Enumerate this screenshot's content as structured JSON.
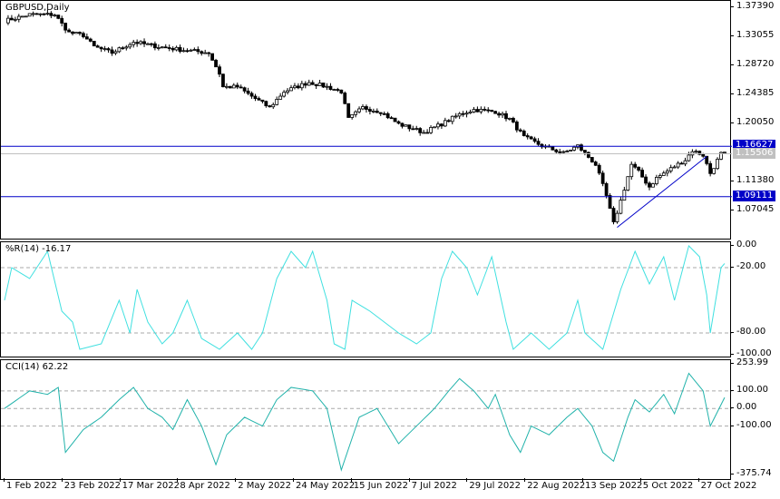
{
  "chart_data": [
    {
      "type": "candlestick",
      "title": "GBPUSD,Daily",
      "symbol": "GBPUSD",
      "timeframe": "Daily",
      "ylim": [
        1.0271,
        1.3834
      ],
      "y_ticks": [
        "1.37390",
        "1.33055",
        "1.28720",
        "1.24385",
        "1.20050",
        "1.11380",
        "1.07045"
      ],
      "close_anchors": [
        [
          0,
          1.3536
        ],
        [
          7,
          1.363
        ],
        [
          14,
          1.363
        ],
        [
          16,
          1.349
        ],
        [
          18,
          1.336
        ],
        [
          22,
          1.332
        ],
        [
          25,
          1.315
        ],
        [
          30,
          1.306
        ],
        [
          36,
          1.322
        ],
        [
          43,
          1.315
        ],
        [
          50,
          1.31
        ],
        [
          57,
          1.306
        ],
        [
          60,
          1.275
        ],
        [
          61,
          1.255
        ],
        [
          65,
          1.255
        ],
        [
          69,
          1.241
        ],
        [
          74,
          1.224
        ],
        [
          78,
          1.248
        ],
        [
          85,
          1.262
        ],
        [
          90,
          1.255
        ],
        [
          94,
          1.248
        ],
        [
          96,
          1.207
        ],
        [
          100,
          1.224
        ],
        [
          105,
          1.218
        ],
        [
          110,
          1.1995
        ],
        [
          117,
          1.187
        ],
        [
          122,
          1.1995
        ],
        [
          127,
          1.214
        ],
        [
          131,
          1.221
        ],
        [
          137,
          1.218
        ],
        [
          141,
          1.207
        ],
        [
          145,
          1.18
        ],
        [
          150,
          1.167
        ],
        [
          156,
          1.156
        ],
        [
          160,
          1.167
        ],
        [
          165,
          1.139
        ],
        [
          168,
          1.092
        ],
        [
          170,
          1.051
        ],
        [
          172,
          1.085
        ],
        [
          175,
          1.139
        ],
        [
          177,
          1.128
        ],
        [
          180,
          1.1057
        ],
        [
          182,
          1.119
        ],
        [
          186,
          1.133
        ],
        [
          190,
          1.146
        ],
        [
          192,
          1.16
        ],
        [
          195,
          1.153
        ],
        [
          197,
          1.126
        ],
        [
          200,
          1.1551
        ]
      ],
      "hlines": [
        {
          "price": 1.16627,
          "label": "1.16627",
          "color": "#0000c8"
        },
        {
          "price": 1.09111,
          "label": "1.09111",
          "color": "#0000c8"
        },
        {
          "price": 1.15506,
          "label": "1.15506",
          "color": "#c0c0c0"
        }
      ],
      "trendline": [
        [
          171,
          1.0452
        ],
        [
          196,
          1.1512
        ]
      ],
      "total_bars": 203
    },
    {
      "type": "line",
      "title": "%R(14) -16.17",
      "name": "%R(14)",
      "last": -16.17,
      "ylim": [
        -100,
        0
      ],
      "y_ticks": [
        "0.00",
        "-20.00",
        "-80.00",
        "-100.00"
      ],
      "levels": [
        -20,
        -80
      ],
      "color": "#40e0e0",
      "anchors": [
        [
          0,
          -50
        ],
        [
          2,
          -20
        ],
        [
          7,
          -30
        ],
        [
          12,
          -5
        ],
        [
          16,
          -60
        ],
        [
          19,
          -70
        ],
        [
          21,
          -95
        ],
        [
          27,
          -90
        ],
        [
          32,
          -50
        ],
        [
          35,
          -80
        ],
        [
          37,
          -40
        ],
        [
          40,
          -70
        ],
        [
          44,
          -90
        ],
        [
          47,
          -80
        ],
        [
          51,
          -50
        ],
        [
          55,
          -85
        ],
        [
          60,
          -95
        ],
        [
          65,
          -80
        ],
        [
          69,
          -95
        ],
        [
          72,
          -80
        ],
        [
          76,
          -30
        ],
        [
          80,
          -5
        ],
        [
          84,
          -20
        ],
        [
          86,
          -5
        ],
        [
          90,
          -50
        ],
        [
          92,
          -90
        ],
        [
          95,
          -95
        ],
        [
          97,
          -50
        ],
        [
          102,
          -60
        ],
        [
          110,
          -80
        ],
        [
          115,
          -90
        ],
        [
          119,
          -80
        ],
        [
          122,
          -30
        ],
        [
          125,
          -5
        ],
        [
          129,
          -20
        ],
        [
          132,
          -45
        ],
        [
          136,
          -10
        ],
        [
          140,
          -70
        ],
        [
          142,
          -95
        ],
        [
          147,
          -80
        ],
        [
          152,
          -95
        ],
        [
          157,
          -80
        ],
        [
          160,
          -50
        ],
        [
          162,
          -80
        ],
        [
          167,
          -95
        ],
        [
          172,
          -40
        ],
        [
          176,
          -5
        ],
        [
          180,
          -35
        ],
        [
          184,
          -10
        ],
        [
          187,
          -50
        ],
        [
          191,
          0
        ],
        [
          194,
          -10
        ],
        [
          196,
          -45
        ],
        [
          197,
          -80
        ],
        [
          200,
          -20
        ],
        [
          201,
          -16.17
        ]
      ]
    },
    {
      "type": "line",
      "title": "CCI(14) 62.22",
      "name": "CCI(14)",
      "last": 62.22,
      "ylim": [
        -375.74,
        253.99
      ],
      "y_ticks": [
        "253.99",
        "100.00",
        "0.00",
        "-100.00",
        "-375.74"
      ],
      "levels": [
        100,
        0,
        -100
      ],
      "color": "#20b2aa",
      "anchors": [
        [
          0,
          0
        ],
        [
          7,
          100
        ],
        [
          12,
          80
        ],
        [
          15,
          120
        ],
        [
          17,
          -250
        ],
        [
          22,
          -120
        ],
        [
          27,
          -50
        ],
        [
          32,
          50
        ],
        [
          36,
          120
        ],
        [
          40,
          0
        ],
        [
          44,
          -50
        ],
        [
          47,
          -120
        ],
        [
          51,
          50
        ],
        [
          55,
          -100
        ],
        [
          59,
          -320
        ],
        [
          62,
          -150
        ],
        [
          67,
          -50
        ],
        [
          72,
          -100
        ],
        [
          76,
          50
        ],
        [
          80,
          120
        ],
        [
          86,
          100
        ],
        [
          90,
          0
        ],
        [
          94,
          -350
        ],
        [
          99,
          -50
        ],
        [
          104,
          0
        ],
        [
          110,
          -200
        ],
        [
          115,
          -100
        ],
        [
          120,
          0
        ],
        [
          124,
          100
        ],
        [
          127,
          170
        ],
        [
          131,
          100
        ],
        [
          135,
          0
        ],
        [
          137,
          80
        ],
        [
          141,
          -150
        ],
        [
          144,
          -250
        ],
        [
          147,
          -100
        ],
        [
          152,
          -150
        ],
        [
          157,
          -50
        ],
        [
          160,
          0
        ],
        [
          164,
          -100
        ],
        [
          167,
          -250
        ],
        [
          170,
          -300
        ],
        [
          174,
          -50
        ],
        [
          176,
          50
        ],
        [
          180,
          -20
        ],
        [
          184,
          80
        ],
        [
          187,
          -30
        ],
        [
          191,
          200
        ],
        [
          195,
          100
        ],
        [
          197,
          -100
        ],
        [
          201,
          62.22
        ]
      ]
    }
  ],
  "x_labels": [
    "1 Feb 2022",
    "23 Feb 2022",
    "17 Mar 2022",
    "8 Apr 2022",
    "2 May 2022",
    "24 May 2022",
    "15 Jun 2022",
    "7 Jul 2022",
    "29 Jul 2022",
    "22 Aug 2022",
    "13 Sep 2022",
    "5 Oct 2022",
    "27 Oct 2022"
  ]
}
